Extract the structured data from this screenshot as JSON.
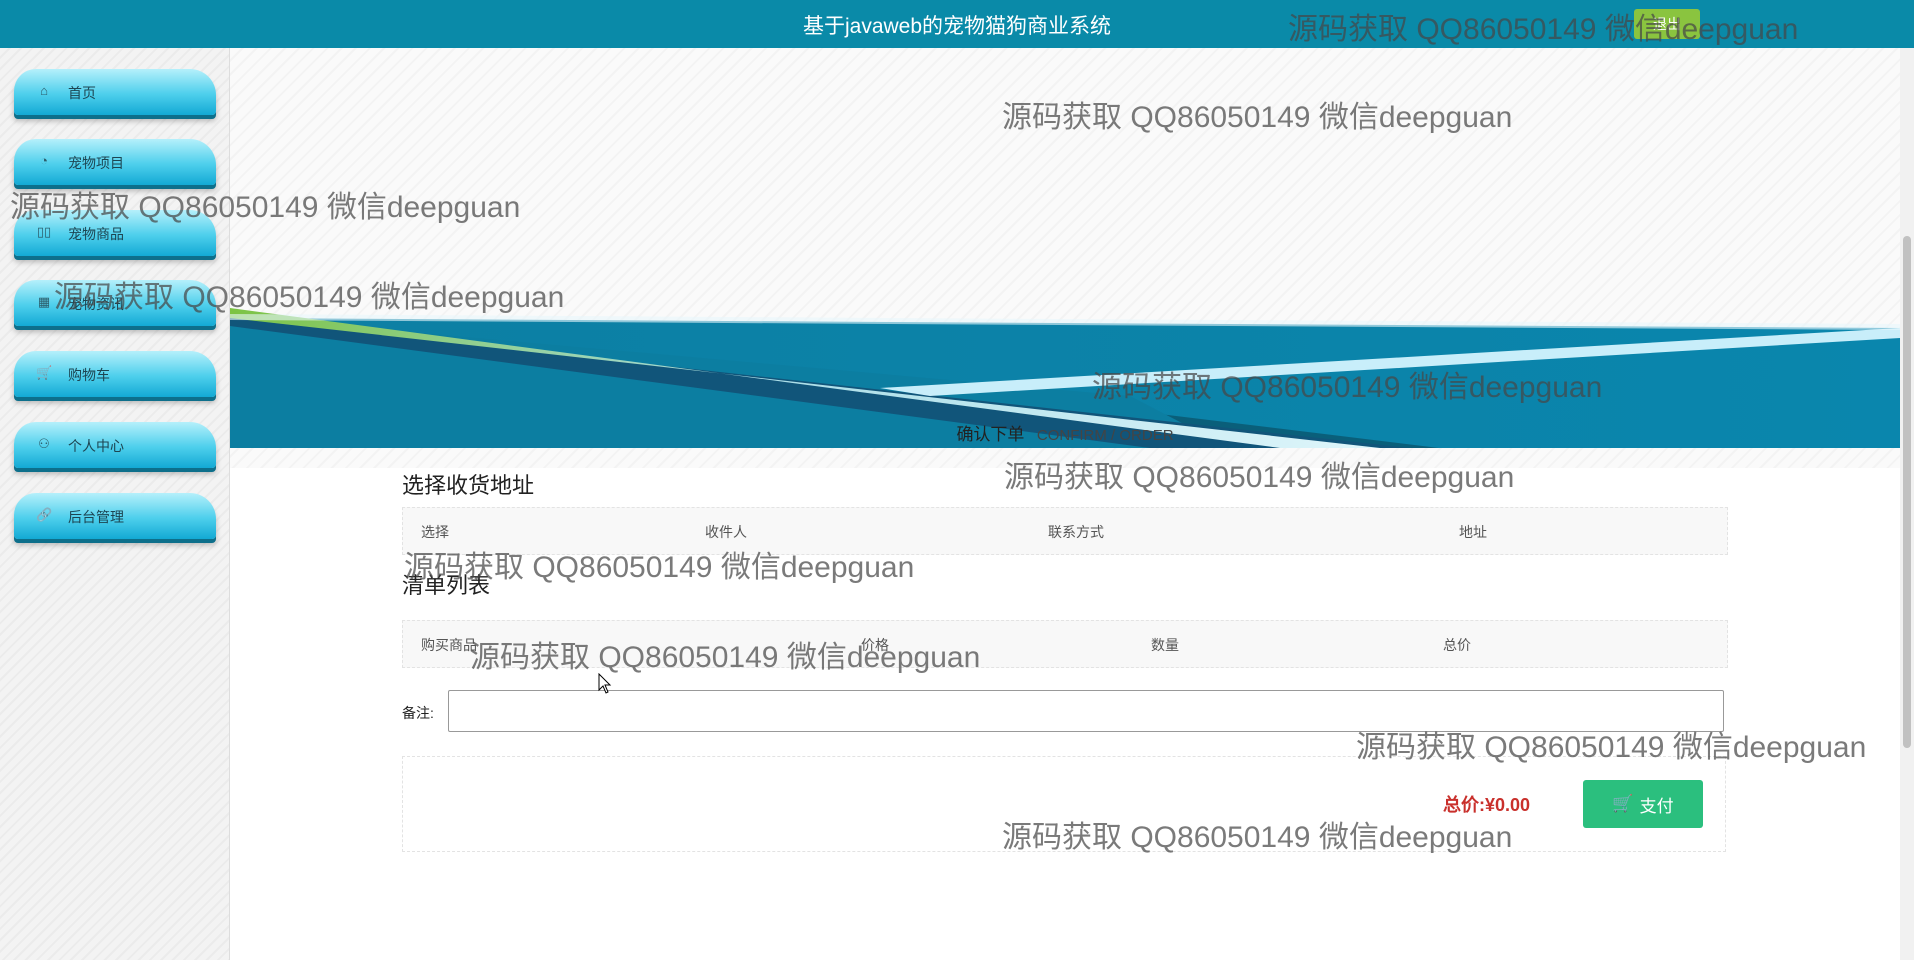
{
  "header": {
    "title": "基于javaweb的宠物猫狗商业系统",
    "badge": "退出"
  },
  "sidebar": {
    "items": [
      {
        "label": "首页",
        "icon": "home-icon"
      },
      {
        "label": "宠物项目",
        "icon": "gauge-icon"
      },
      {
        "label": "宠物商品",
        "icon": "columns-icon"
      },
      {
        "label": "宠物资讯",
        "icon": "calendar-icon"
      },
      {
        "label": "购物车",
        "icon": "cart-icon"
      },
      {
        "label": "个人中心",
        "icon": "user-icon"
      },
      {
        "label": "后台管理",
        "icon": "link-icon"
      }
    ]
  },
  "confirm": {
    "cn": "确认下单",
    "en": "CONFIRM / ORDER"
  },
  "address": {
    "title": "选择收货地址",
    "columns": [
      "选择",
      "收件人",
      "联系方式",
      "地址"
    ]
  },
  "items": {
    "title": "清单列表",
    "columns": [
      "购买商品",
      "价格",
      "数量",
      "总价"
    ]
  },
  "remark": {
    "label": "备注:",
    "value": ""
  },
  "payment": {
    "total_label": "总价:¥0.00",
    "button_label": "支付"
  },
  "watermark": "源码获取 QQ86050149 微信deepguan",
  "colors": {
    "header": "#0a8aa8",
    "pay_button": "#2bbf7e",
    "total": "#c9302c",
    "nav": "#4dcfec"
  }
}
